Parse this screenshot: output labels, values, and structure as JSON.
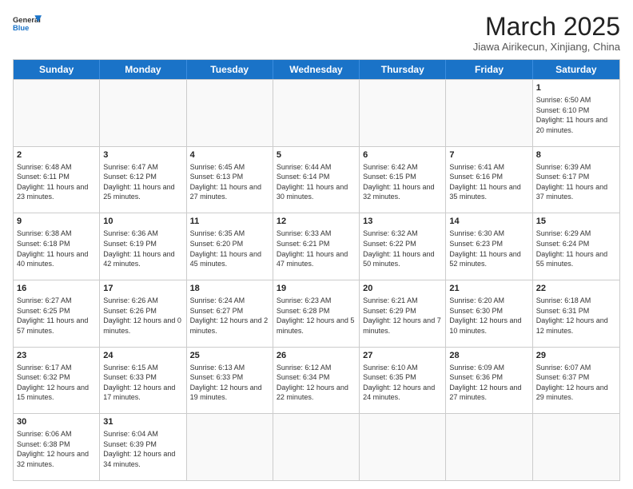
{
  "header": {
    "logo_general": "General",
    "logo_blue": "Blue",
    "month_title": "March 2025",
    "location": "Jiawa Airikecun, Xinjiang, China"
  },
  "weekdays": [
    "Sunday",
    "Monday",
    "Tuesday",
    "Wednesday",
    "Thursday",
    "Friday",
    "Saturday"
  ],
  "weeks": [
    [
      {
        "day": "",
        "sunrise": "",
        "sunset": "",
        "daylight": ""
      },
      {
        "day": "",
        "sunrise": "",
        "sunset": "",
        "daylight": ""
      },
      {
        "day": "",
        "sunrise": "",
        "sunset": "",
        "daylight": ""
      },
      {
        "day": "",
        "sunrise": "",
        "sunset": "",
        "daylight": ""
      },
      {
        "day": "",
        "sunrise": "",
        "sunset": "",
        "daylight": ""
      },
      {
        "day": "",
        "sunrise": "",
        "sunset": "",
        "daylight": ""
      },
      {
        "day": "1",
        "sunrise": "Sunrise: 6:50 AM",
        "sunset": "Sunset: 6:10 PM",
        "daylight": "Daylight: 11 hours and 20 minutes."
      }
    ],
    [
      {
        "day": "2",
        "sunrise": "Sunrise: 6:48 AM",
        "sunset": "Sunset: 6:11 PM",
        "daylight": "Daylight: 11 hours and 23 minutes."
      },
      {
        "day": "3",
        "sunrise": "Sunrise: 6:47 AM",
        "sunset": "Sunset: 6:12 PM",
        "daylight": "Daylight: 11 hours and 25 minutes."
      },
      {
        "day": "4",
        "sunrise": "Sunrise: 6:45 AM",
        "sunset": "Sunset: 6:13 PM",
        "daylight": "Daylight: 11 hours and 27 minutes."
      },
      {
        "day": "5",
        "sunrise": "Sunrise: 6:44 AM",
        "sunset": "Sunset: 6:14 PM",
        "daylight": "Daylight: 11 hours and 30 minutes."
      },
      {
        "day": "6",
        "sunrise": "Sunrise: 6:42 AM",
        "sunset": "Sunset: 6:15 PM",
        "daylight": "Daylight: 11 hours and 32 minutes."
      },
      {
        "day": "7",
        "sunrise": "Sunrise: 6:41 AM",
        "sunset": "Sunset: 6:16 PM",
        "daylight": "Daylight: 11 hours and 35 minutes."
      },
      {
        "day": "8",
        "sunrise": "Sunrise: 6:39 AM",
        "sunset": "Sunset: 6:17 PM",
        "daylight": "Daylight: 11 hours and 37 minutes."
      }
    ],
    [
      {
        "day": "9",
        "sunrise": "Sunrise: 6:38 AM",
        "sunset": "Sunset: 6:18 PM",
        "daylight": "Daylight: 11 hours and 40 minutes."
      },
      {
        "day": "10",
        "sunrise": "Sunrise: 6:36 AM",
        "sunset": "Sunset: 6:19 PM",
        "daylight": "Daylight: 11 hours and 42 minutes."
      },
      {
        "day": "11",
        "sunrise": "Sunrise: 6:35 AM",
        "sunset": "Sunset: 6:20 PM",
        "daylight": "Daylight: 11 hours and 45 minutes."
      },
      {
        "day": "12",
        "sunrise": "Sunrise: 6:33 AM",
        "sunset": "Sunset: 6:21 PM",
        "daylight": "Daylight: 11 hours and 47 minutes."
      },
      {
        "day": "13",
        "sunrise": "Sunrise: 6:32 AM",
        "sunset": "Sunset: 6:22 PM",
        "daylight": "Daylight: 11 hours and 50 minutes."
      },
      {
        "day": "14",
        "sunrise": "Sunrise: 6:30 AM",
        "sunset": "Sunset: 6:23 PM",
        "daylight": "Daylight: 11 hours and 52 minutes."
      },
      {
        "day": "15",
        "sunrise": "Sunrise: 6:29 AM",
        "sunset": "Sunset: 6:24 PM",
        "daylight": "Daylight: 11 hours and 55 minutes."
      }
    ],
    [
      {
        "day": "16",
        "sunrise": "Sunrise: 6:27 AM",
        "sunset": "Sunset: 6:25 PM",
        "daylight": "Daylight: 11 hours and 57 minutes."
      },
      {
        "day": "17",
        "sunrise": "Sunrise: 6:26 AM",
        "sunset": "Sunset: 6:26 PM",
        "daylight": "Daylight: 12 hours and 0 minutes."
      },
      {
        "day": "18",
        "sunrise": "Sunrise: 6:24 AM",
        "sunset": "Sunset: 6:27 PM",
        "daylight": "Daylight: 12 hours and 2 minutes."
      },
      {
        "day": "19",
        "sunrise": "Sunrise: 6:23 AM",
        "sunset": "Sunset: 6:28 PM",
        "daylight": "Daylight: 12 hours and 5 minutes."
      },
      {
        "day": "20",
        "sunrise": "Sunrise: 6:21 AM",
        "sunset": "Sunset: 6:29 PM",
        "daylight": "Daylight: 12 hours and 7 minutes."
      },
      {
        "day": "21",
        "sunrise": "Sunrise: 6:20 AM",
        "sunset": "Sunset: 6:30 PM",
        "daylight": "Daylight: 12 hours and 10 minutes."
      },
      {
        "day": "22",
        "sunrise": "Sunrise: 6:18 AM",
        "sunset": "Sunset: 6:31 PM",
        "daylight": "Daylight: 12 hours and 12 minutes."
      }
    ],
    [
      {
        "day": "23",
        "sunrise": "Sunrise: 6:17 AM",
        "sunset": "Sunset: 6:32 PM",
        "daylight": "Daylight: 12 hours and 15 minutes."
      },
      {
        "day": "24",
        "sunrise": "Sunrise: 6:15 AM",
        "sunset": "Sunset: 6:33 PM",
        "daylight": "Daylight: 12 hours and 17 minutes."
      },
      {
        "day": "25",
        "sunrise": "Sunrise: 6:13 AM",
        "sunset": "Sunset: 6:33 PM",
        "daylight": "Daylight: 12 hours and 19 minutes."
      },
      {
        "day": "26",
        "sunrise": "Sunrise: 6:12 AM",
        "sunset": "Sunset: 6:34 PM",
        "daylight": "Daylight: 12 hours and 22 minutes."
      },
      {
        "day": "27",
        "sunrise": "Sunrise: 6:10 AM",
        "sunset": "Sunset: 6:35 PM",
        "daylight": "Daylight: 12 hours and 24 minutes."
      },
      {
        "day": "28",
        "sunrise": "Sunrise: 6:09 AM",
        "sunset": "Sunset: 6:36 PM",
        "daylight": "Daylight: 12 hours and 27 minutes."
      },
      {
        "day": "29",
        "sunrise": "Sunrise: 6:07 AM",
        "sunset": "Sunset: 6:37 PM",
        "daylight": "Daylight: 12 hours and 29 minutes."
      }
    ],
    [
      {
        "day": "30",
        "sunrise": "Sunrise: 6:06 AM",
        "sunset": "Sunset: 6:38 PM",
        "daylight": "Daylight: 12 hours and 32 minutes."
      },
      {
        "day": "31",
        "sunrise": "Sunrise: 6:04 AM",
        "sunset": "Sunset: 6:39 PM",
        "daylight": "Daylight: 12 hours and 34 minutes."
      },
      {
        "day": "",
        "sunrise": "",
        "sunset": "",
        "daylight": ""
      },
      {
        "day": "",
        "sunrise": "",
        "sunset": "",
        "daylight": ""
      },
      {
        "day": "",
        "sunrise": "",
        "sunset": "",
        "daylight": ""
      },
      {
        "day": "",
        "sunrise": "",
        "sunset": "",
        "daylight": ""
      },
      {
        "day": "",
        "sunrise": "",
        "sunset": "",
        "daylight": ""
      }
    ]
  ]
}
